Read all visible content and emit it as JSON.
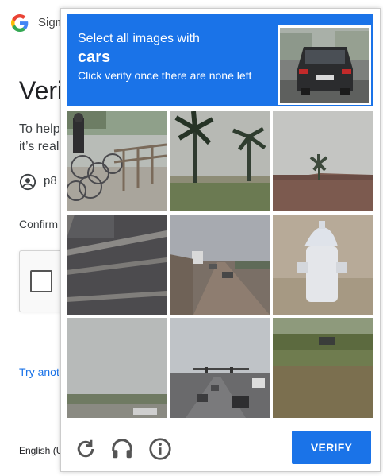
{
  "background": {
    "sign_text": "Sign",
    "title": "Veri",
    "desc_line1": "To help",
    "desc_line2": "it’s real",
    "account_text": "p8",
    "confirm_text": "Confirm",
    "try_another": "Try anot",
    "language": "English (U"
  },
  "challenge": {
    "header": {
      "line1": "Select all images with",
      "keyword": "cars",
      "line3": "Click verify once there are none left",
      "sample_icon": "car-rear-photo"
    },
    "tiles": [
      {
        "icon": "bicycles-photo"
      },
      {
        "icon": "palm-trees-photo"
      },
      {
        "icon": "palm-roof-photo"
      },
      {
        "icon": "crosswalk-photo"
      },
      {
        "icon": "highway-cars-photo"
      },
      {
        "icon": "fire-hydrant-photo"
      },
      {
        "icon": "overcast-sky-photo"
      },
      {
        "icon": "street-traffic-photo"
      },
      {
        "icon": "field-car-photo"
      }
    ],
    "footer": {
      "reload_icon": "reload-icon",
      "audio_icon": "headphones-icon",
      "info_icon": "info-icon",
      "verify_label": "VERIFY"
    }
  },
  "colors": {
    "accent": "#1a73e8",
    "link": "#1a73e8"
  }
}
